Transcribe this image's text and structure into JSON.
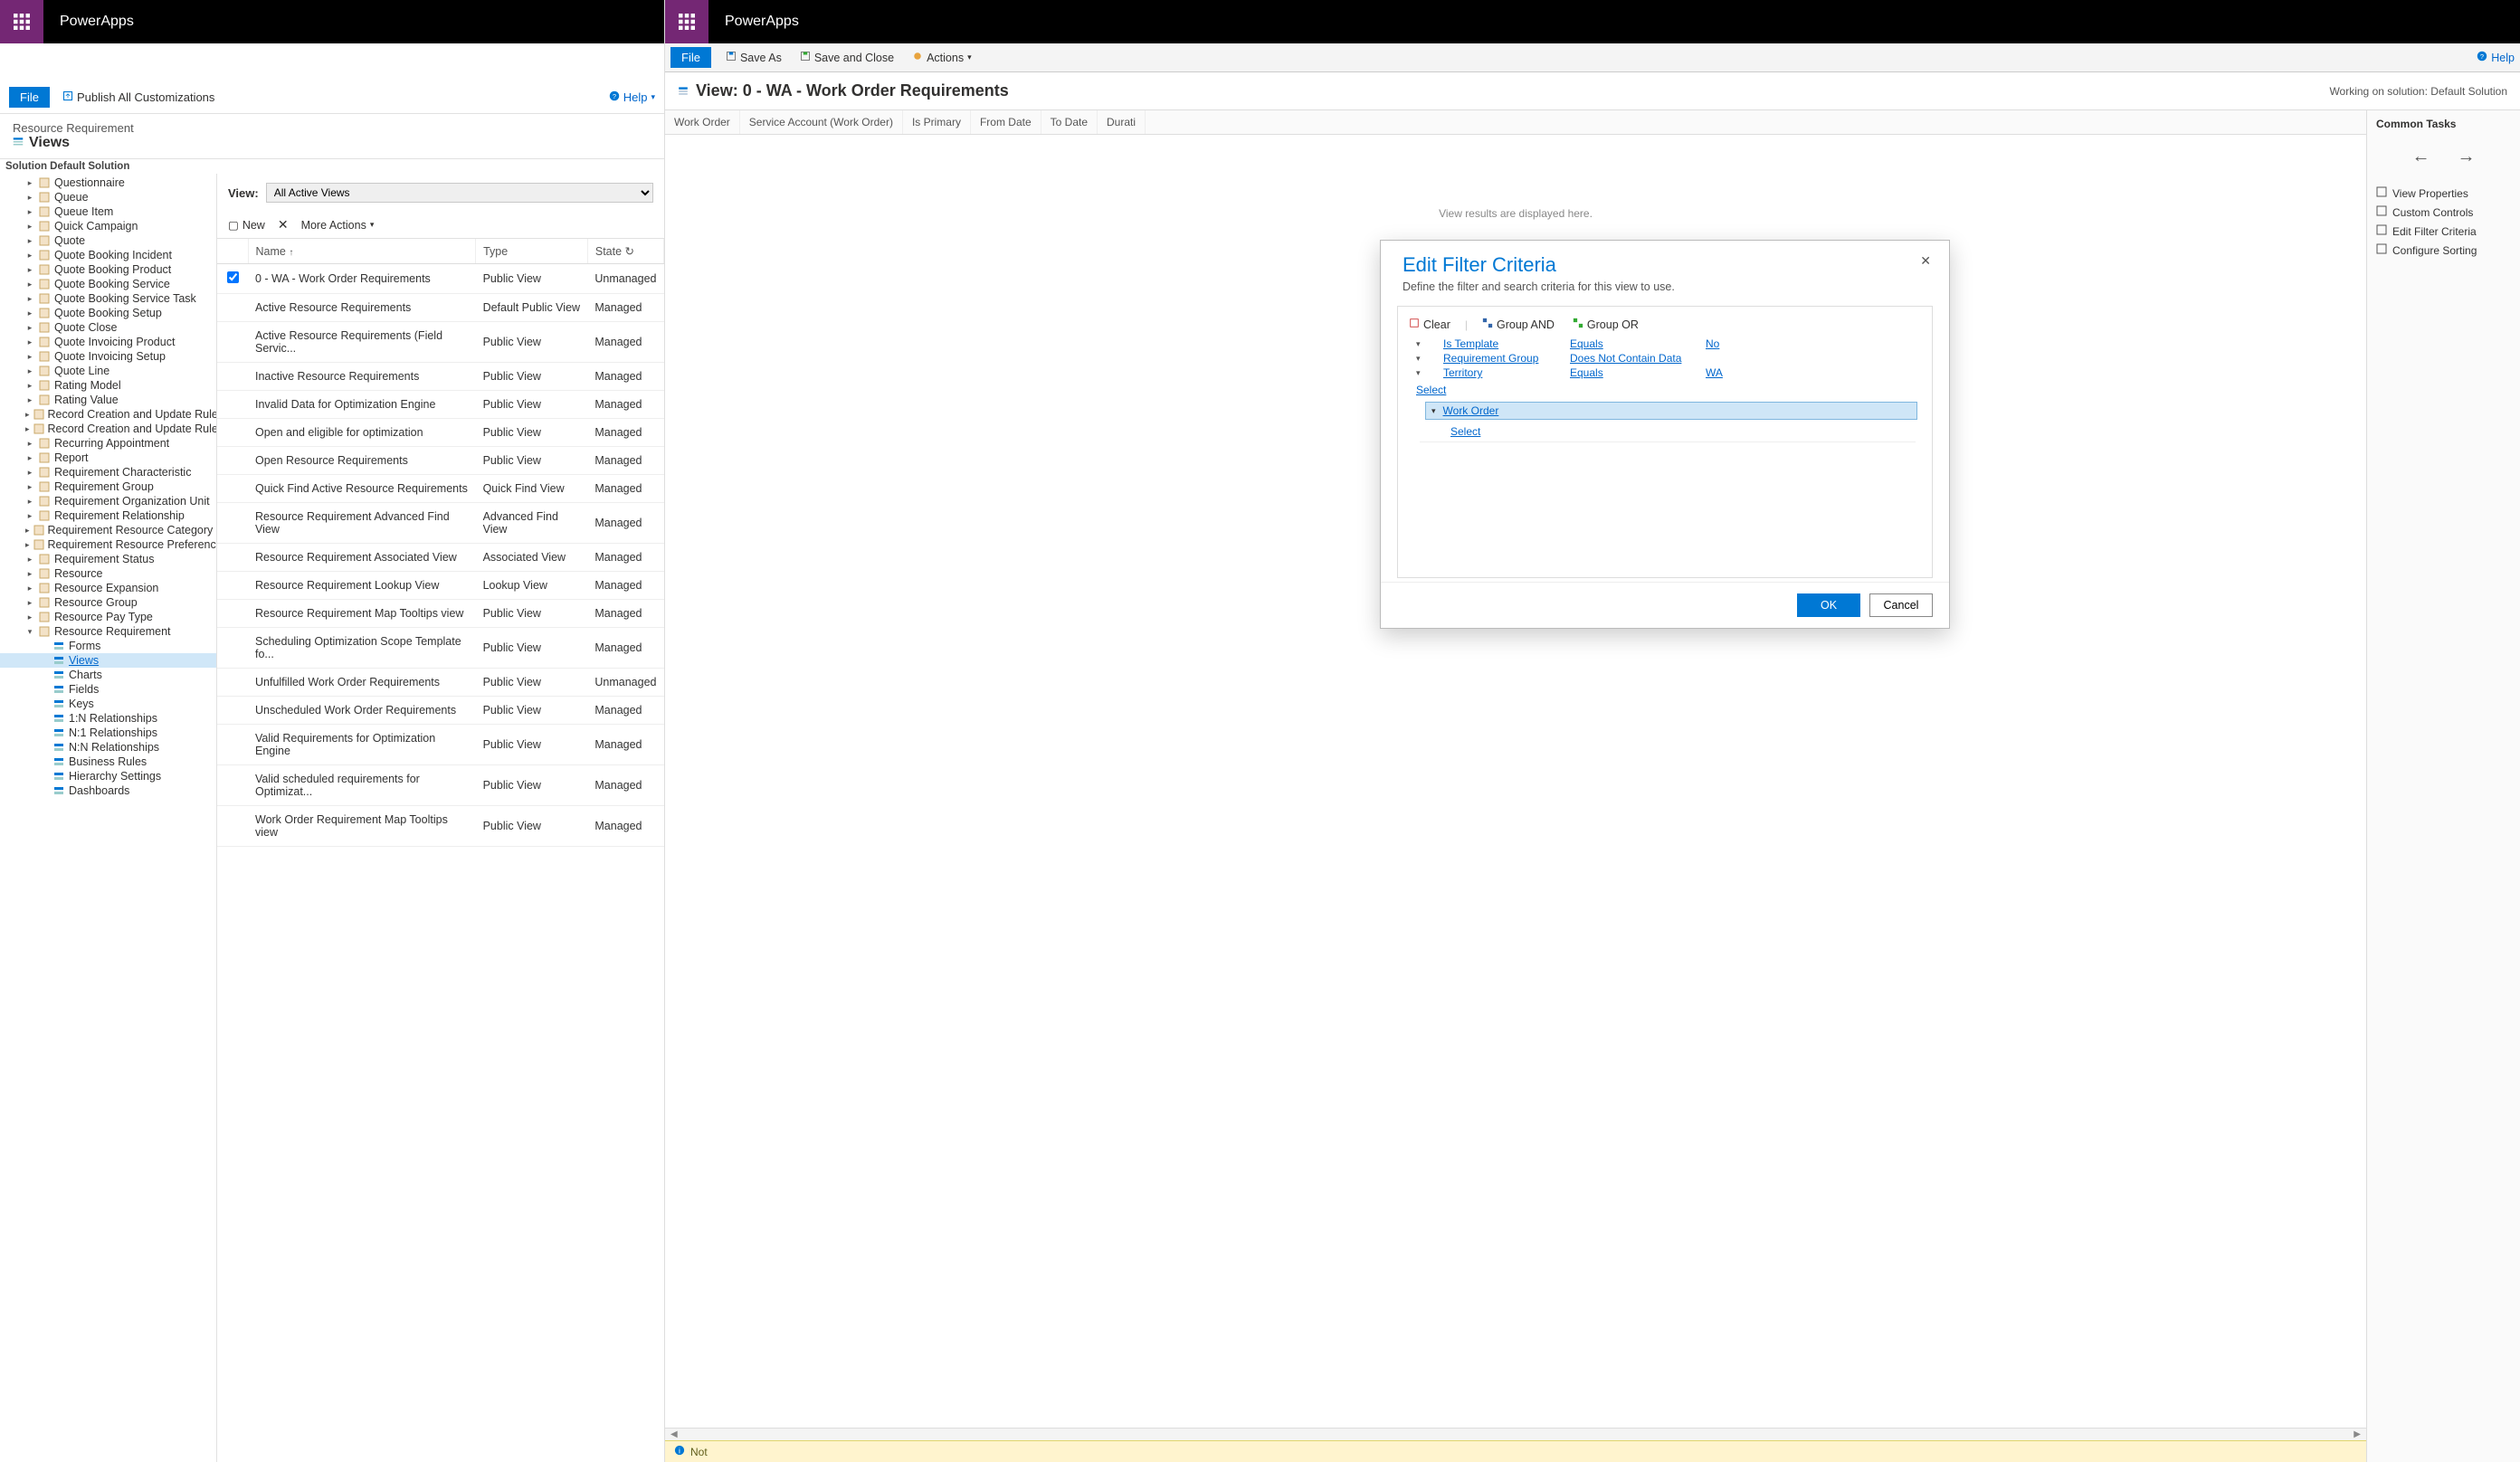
{
  "brand": "PowerApps",
  "left": {
    "file": "File",
    "publish": "Publish All Customizations",
    "help": "Help",
    "entity": "Resource Requirement",
    "section": "Views",
    "solution": "Solution Default Solution",
    "view_label": "View:",
    "view_dd": "All Active Views",
    "tb_new": "New",
    "tb_more": "More Actions",
    "cols": {
      "name": "Name",
      "type": "Type",
      "state": "State"
    },
    "tree": [
      "Questionnaire",
      "Queue",
      "Queue Item",
      "Quick Campaign",
      "Quote",
      "Quote Booking Incident",
      "Quote Booking Product",
      "Quote Booking Service",
      "Quote Booking Service Task",
      "Quote Booking Setup",
      "Quote Close",
      "Quote Invoicing Product",
      "Quote Invoicing Setup",
      "Quote Line",
      "Rating Model",
      "Rating Value",
      "Record Creation and Update Rule",
      "Record Creation and Update Rule Item",
      "Recurring Appointment",
      "Report",
      "Requirement Characteristic",
      "Requirement Group",
      "Requirement Organization Unit",
      "Requirement Relationship",
      "Requirement Resource Category",
      "Requirement Resource Preference",
      "Requirement Status",
      "Resource",
      "Resource Expansion",
      "Resource Group",
      "Resource Pay Type",
      "Resource Requirement"
    ],
    "tree_children": [
      "Forms",
      "Views",
      "Charts",
      "Fields",
      "Keys",
      "1:N Relationships",
      "N:1 Relationships",
      "N:N Relationships",
      "Business Rules",
      "Hierarchy Settings",
      "Dashboards"
    ],
    "rows": [
      {
        "n": "0 - WA - Work Order Requirements",
        "t": "Public View",
        "s": "Unmanaged",
        "chk": true
      },
      {
        "n": "Active Resource Requirements",
        "t": "Default Public View",
        "s": "Managed"
      },
      {
        "n": "Active Resource Requirements (Field Servic...",
        "t": "Public View",
        "s": "Managed"
      },
      {
        "n": "Inactive Resource Requirements",
        "t": "Public View",
        "s": "Managed"
      },
      {
        "n": "Invalid Data for Optimization Engine",
        "t": "Public View",
        "s": "Managed"
      },
      {
        "n": "Open and eligible for optimization",
        "t": "Public View",
        "s": "Managed"
      },
      {
        "n": "Open Resource Requirements",
        "t": "Public View",
        "s": "Managed"
      },
      {
        "n": "Quick Find Active Resource Requirements",
        "t": "Quick Find View",
        "s": "Managed"
      },
      {
        "n": "Resource Requirement Advanced Find View",
        "t": "Advanced Find View",
        "s": "Managed"
      },
      {
        "n": "Resource Requirement Associated View",
        "t": "Associated View",
        "s": "Managed"
      },
      {
        "n": "Resource Requirement Lookup View",
        "t": "Lookup View",
        "s": "Managed"
      },
      {
        "n": "Resource Requirement Map Tooltips view",
        "t": "Public View",
        "s": "Managed"
      },
      {
        "n": "Scheduling Optimization Scope Template fo...",
        "t": "Public View",
        "s": "Managed"
      },
      {
        "n": "Unfulfilled Work Order Requirements",
        "t": "Public View",
        "s": "Unmanaged"
      },
      {
        "n": "Unscheduled Work Order Requirements",
        "t": "Public View",
        "s": "Managed"
      },
      {
        "n": "Valid Requirements for Optimization Engine",
        "t": "Public View",
        "s": "Managed"
      },
      {
        "n": "Valid scheduled requirements for Optimizat...",
        "t": "Public View",
        "s": "Managed"
      },
      {
        "n": "Work Order Requirement Map Tooltips view",
        "t": "Public View",
        "s": "Managed"
      }
    ]
  },
  "right": {
    "file": "File",
    "saveas": "Save As",
    "saveclose": "Save and Close",
    "actions": "Actions",
    "help": "Help",
    "title": "View: 0 - WA - Work Order Requirements",
    "working": "Working on solution: Default Solution",
    "cols": [
      "Work Order",
      "Service Account (Work Order)",
      "Is Primary",
      "From Date",
      "To Date",
      "Durati"
    ],
    "preview_msg": "View results are displayed here.",
    "tasks_title": "Common Tasks",
    "task_links": [
      "View Properties",
      "Custom Controls",
      "Edit Filter Criteria",
      "Configure Sorting"
    ],
    "note": "Not"
  },
  "modal": {
    "title": "Edit Filter Criteria",
    "sub": "Define the filter and search criteria for this view to use.",
    "clear": "Clear",
    "gand": "Group AND",
    "gor": "Group OR",
    "conds": [
      {
        "f": "Is Template",
        "o": "Equals",
        "v": "No"
      },
      {
        "f": "Requirement Group",
        "o": "Does Not Contain Data",
        "v": ""
      },
      {
        "f": "Territory",
        "o": "Equals",
        "v": "WA"
      }
    ],
    "select": "Select",
    "related": "Work Order",
    "ok": "OK",
    "cancel": "Cancel"
  }
}
